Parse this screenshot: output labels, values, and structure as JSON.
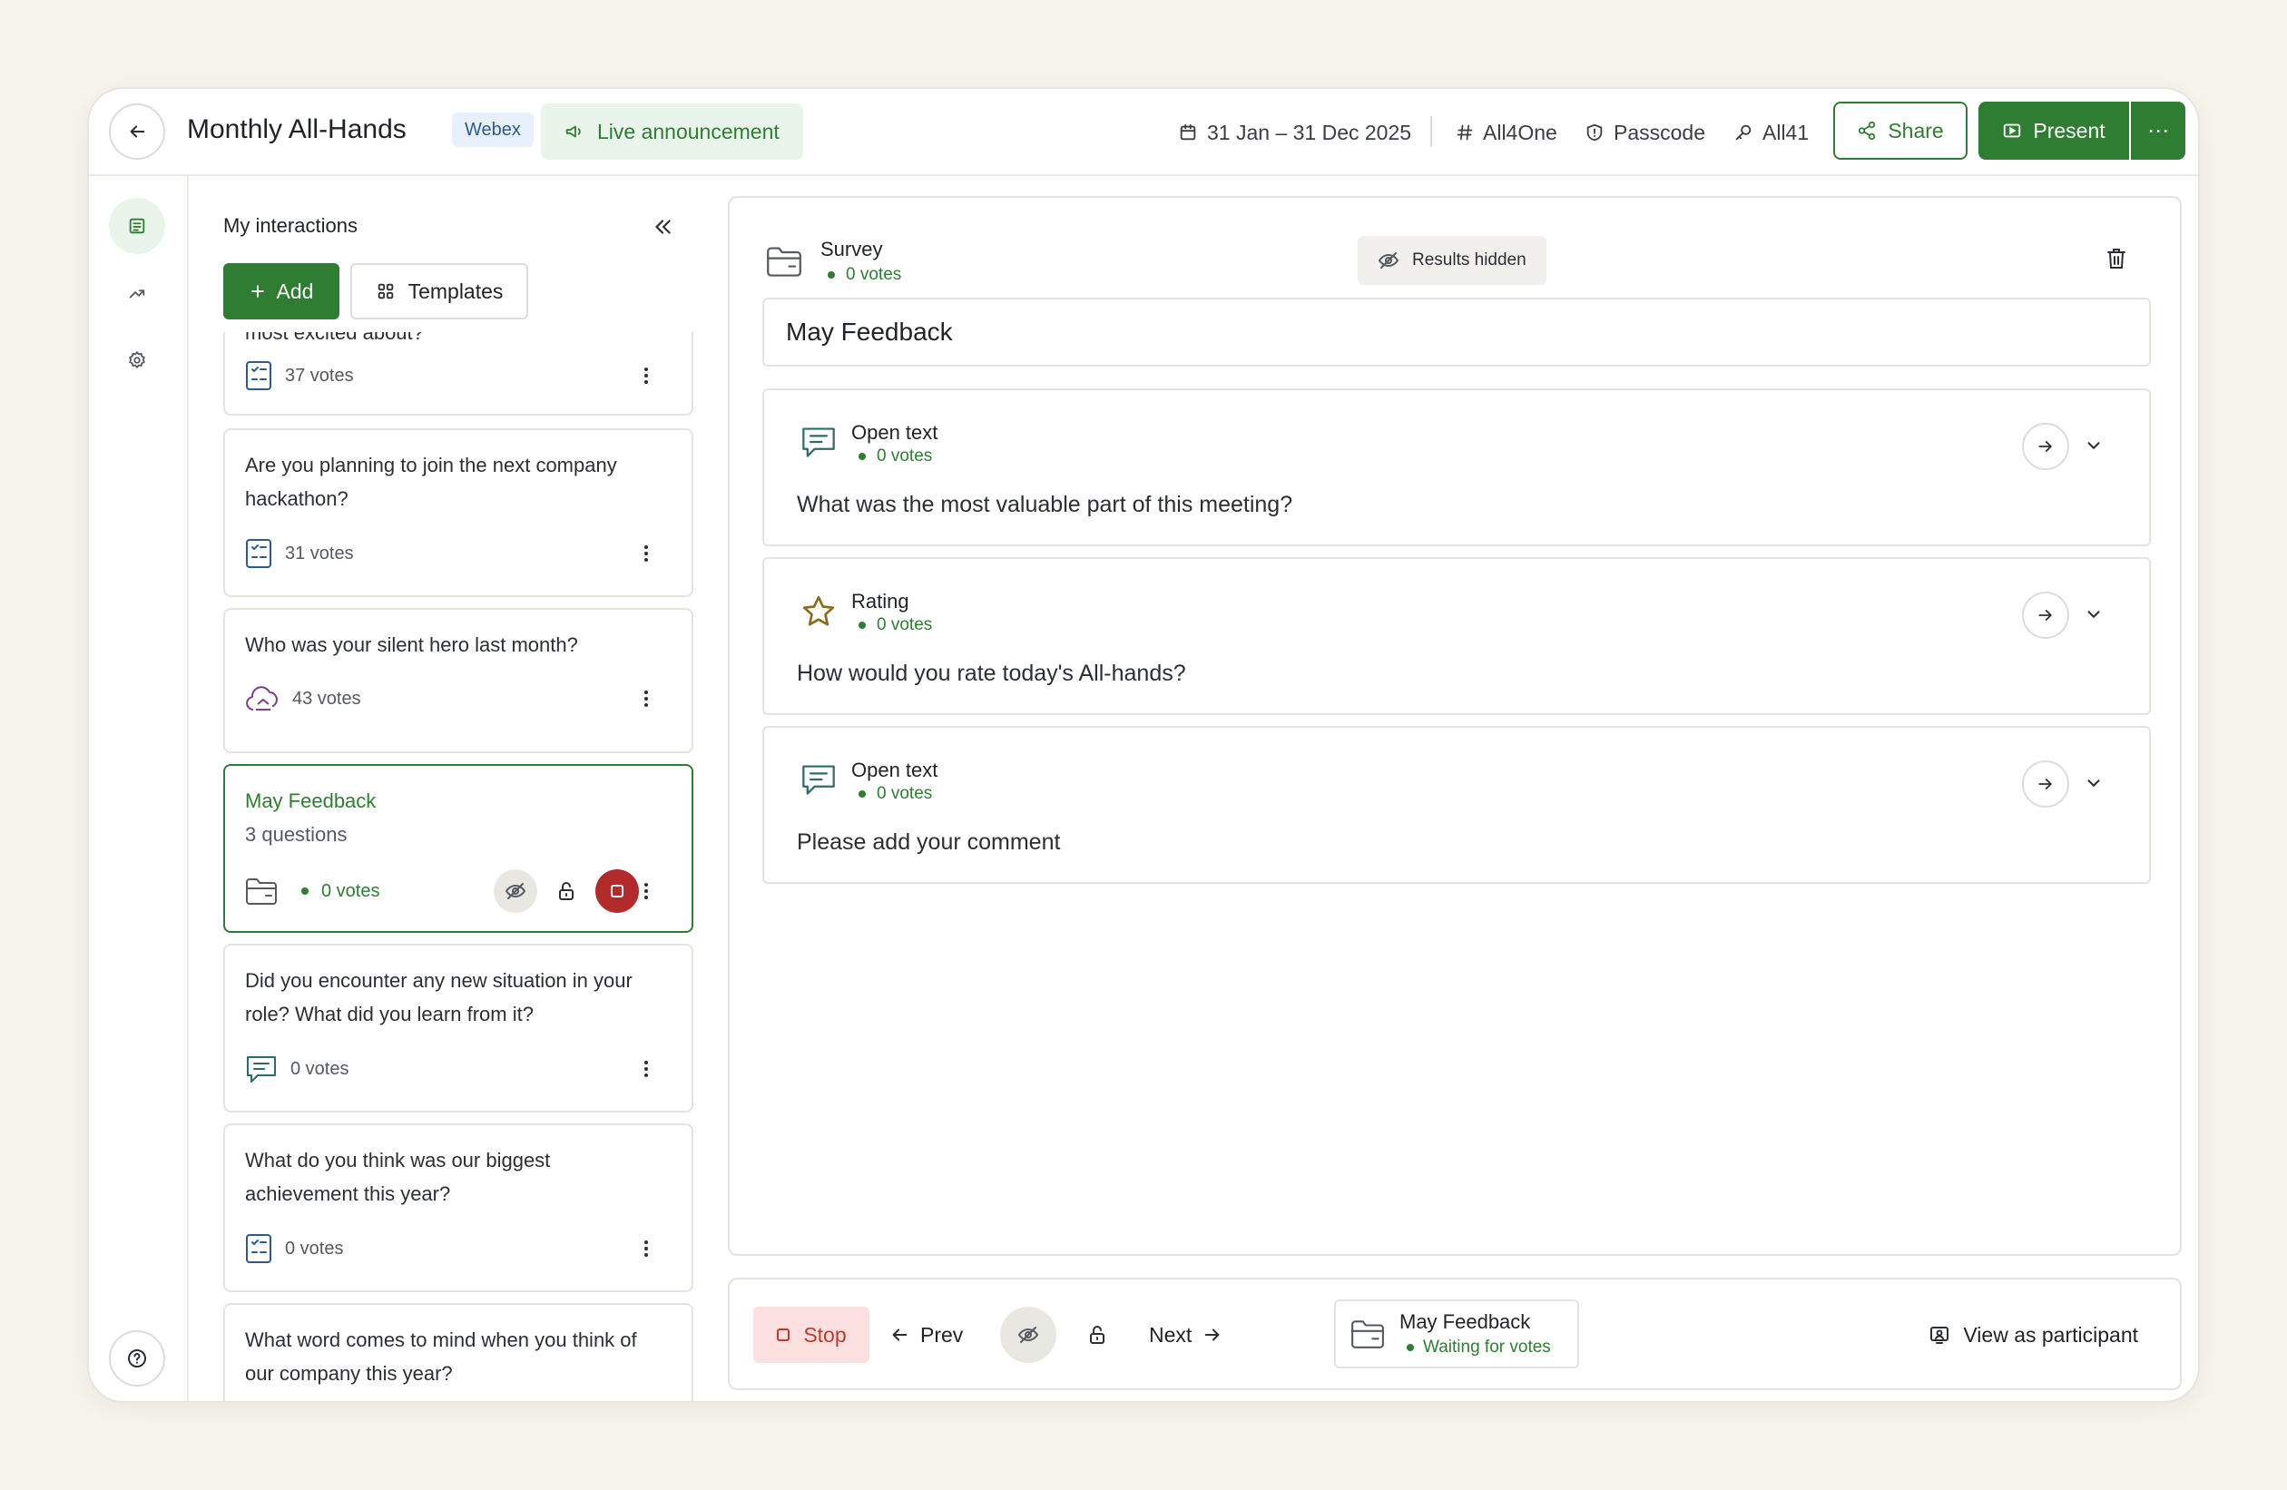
{
  "header": {
    "title": "Monthly All-Hands",
    "platform_badge": "Webex",
    "live_label": "Live announcement",
    "date_range": "31 Jan – 31 Dec 2025",
    "event_code": "All4One",
    "passcode_label": "Passcode",
    "key_value": "All41",
    "share_label": "Share",
    "present_label": "Present",
    "more_label": "⋯"
  },
  "panel": {
    "title": "My interactions",
    "add_label": "Add",
    "templates_label": "Templates",
    "cards": [
      {
        "question": "most excited about?",
        "votes": "37 votes",
        "icon": "poll-icon"
      },
      {
        "question": "Are you planning to join the next company hackathon?",
        "votes": "31 votes",
        "icon": "poll-icon"
      },
      {
        "question": "Who was your silent hero last month?",
        "votes": "43 votes",
        "icon": "word-cloud-icon"
      },
      {
        "question": "May Feedback",
        "subtitle": "3 questions",
        "votes": "0 votes",
        "icon": "folder-icon",
        "selected": true
      },
      {
        "question": "Did you encounter any new situation in your role? What did you learn from it?",
        "votes": "0 votes",
        "icon": "open-text-icon"
      },
      {
        "question": "What do you think was our biggest achievement this year?",
        "votes": "0 votes",
        "icon": "poll-icon"
      },
      {
        "question": "What word comes to mind when you think of our company this year?",
        "votes": "",
        "icon": "word-cloud-icon"
      }
    ]
  },
  "survey": {
    "type_label": "Survey",
    "votes": "0 votes",
    "results_label": "Results hidden",
    "name": "May Feedback",
    "questions": [
      {
        "type": "Open text",
        "votes": "0 votes",
        "text": "What was the most valuable part of this meeting?",
        "icon": "open-text-icon"
      },
      {
        "type": "Rating",
        "votes": "0 votes",
        "text": "How would you rate today's All-hands?",
        "icon": "star-icon"
      },
      {
        "type": "Open text",
        "votes": "0 votes",
        "text": "Please add your comment",
        "icon": "open-text-icon"
      }
    ]
  },
  "controls": {
    "stop_label": "Stop",
    "prev_label": "Prev",
    "next_label": "Next",
    "current_title": "May Feedback",
    "current_status": "Waiting for votes",
    "participant_label": "View as participant"
  },
  "colors": {
    "accent": "#2e7d32",
    "danger": "#c0392b",
    "background": "#f7f4ec"
  }
}
